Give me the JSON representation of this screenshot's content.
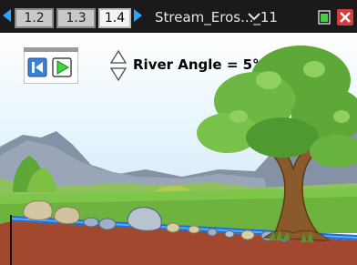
{
  "tabs": [
    {
      "label": "1.2",
      "active": false
    },
    {
      "label": "1.3",
      "active": false
    },
    {
      "label": "1.4",
      "active": true
    }
  ],
  "document": {
    "title": "Stream_Eros..._11"
  },
  "icons": {
    "nav_left": "left-arrow-icon",
    "nav_right": "right-arrow-icon",
    "title_menu": "chevron-down-icon",
    "battery": "battery-icon",
    "close": "close-icon",
    "reset": "skip-back-icon",
    "play": "play-icon",
    "stepper": "up-down-arrows-icon"
  },
  "simulation": {
    "angle_label": "River Angle = 5°"
  },
  "colors": {
    "topbar": "#1a1a1a",
    "accent": "#2aa6ff",
    "sky": "#d6eefb",
    "water": "#1f6fd6",
    "soil": "#a2482e",
    "grass": "#7ec64a"
  }
}
